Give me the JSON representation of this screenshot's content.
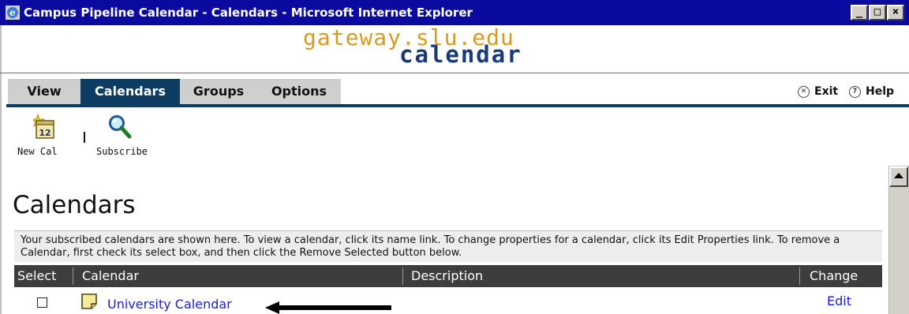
{
  "window": {
    "title": "Campus Pipeline Calendar - Calendars - Microsoft Internet Explorer",
    "minimize": "_",
    "maximize": "□",
    "close": "×"
  },
  "logo": {
    "line1": "gateway.slu.edu",
    "line2": "calendar"
  },
  "tabs": [
    {
      "label": "View",
      "active": false
    },
    {
      "label": "Calendars",
      "active": true
    },
    {
      "label": "Groups",
      "active": false
    },
    {
      "label": "Options",
      "active": false
    }
  ],
  "header_links": {
    "exit": "Exit",
    "help": "Help",
    "exit_icon": "x-circle-icon",
    "help_icon": "question-circle-icon"
  },
  "toolbar": {
    "new_cal": "New Cal",
    "new_cal_icon": "calendar-12-icon",
    "subscribe": "Subscribe",
    "subscribe_icon": "magnifier-icon"
  },
  "page": {
    "title": "Calendars",
    "info": "Your subscribed calendars are shown here. To view a calendar, click its name link. To change properties for a calendar, click its Edit Properties link. To remove a Calendar, first check its select box, and then click the Remove Selected button below."
  },
  "table": {
    "headers": [
      "Select",
      "Calendar",
      "Description",
      "Change"
    ],
    "rows": [
      {
        "selected": false,
        "calendar": "University Calendar",
        "description": "",
        "change": "Edit"
      }
    ]
  },
  "colors": {
    "titlebar": "#0a0aa0",
    "tab_active": "#0d3c63",
    "tab_inactive": "#cfcfcf",
    "table_header": "#3d3d3d",
    "link": "#1a1adc",
    "logo_orange": "#d99a22",
    "logo_navy": "#183a78"
  }
}
